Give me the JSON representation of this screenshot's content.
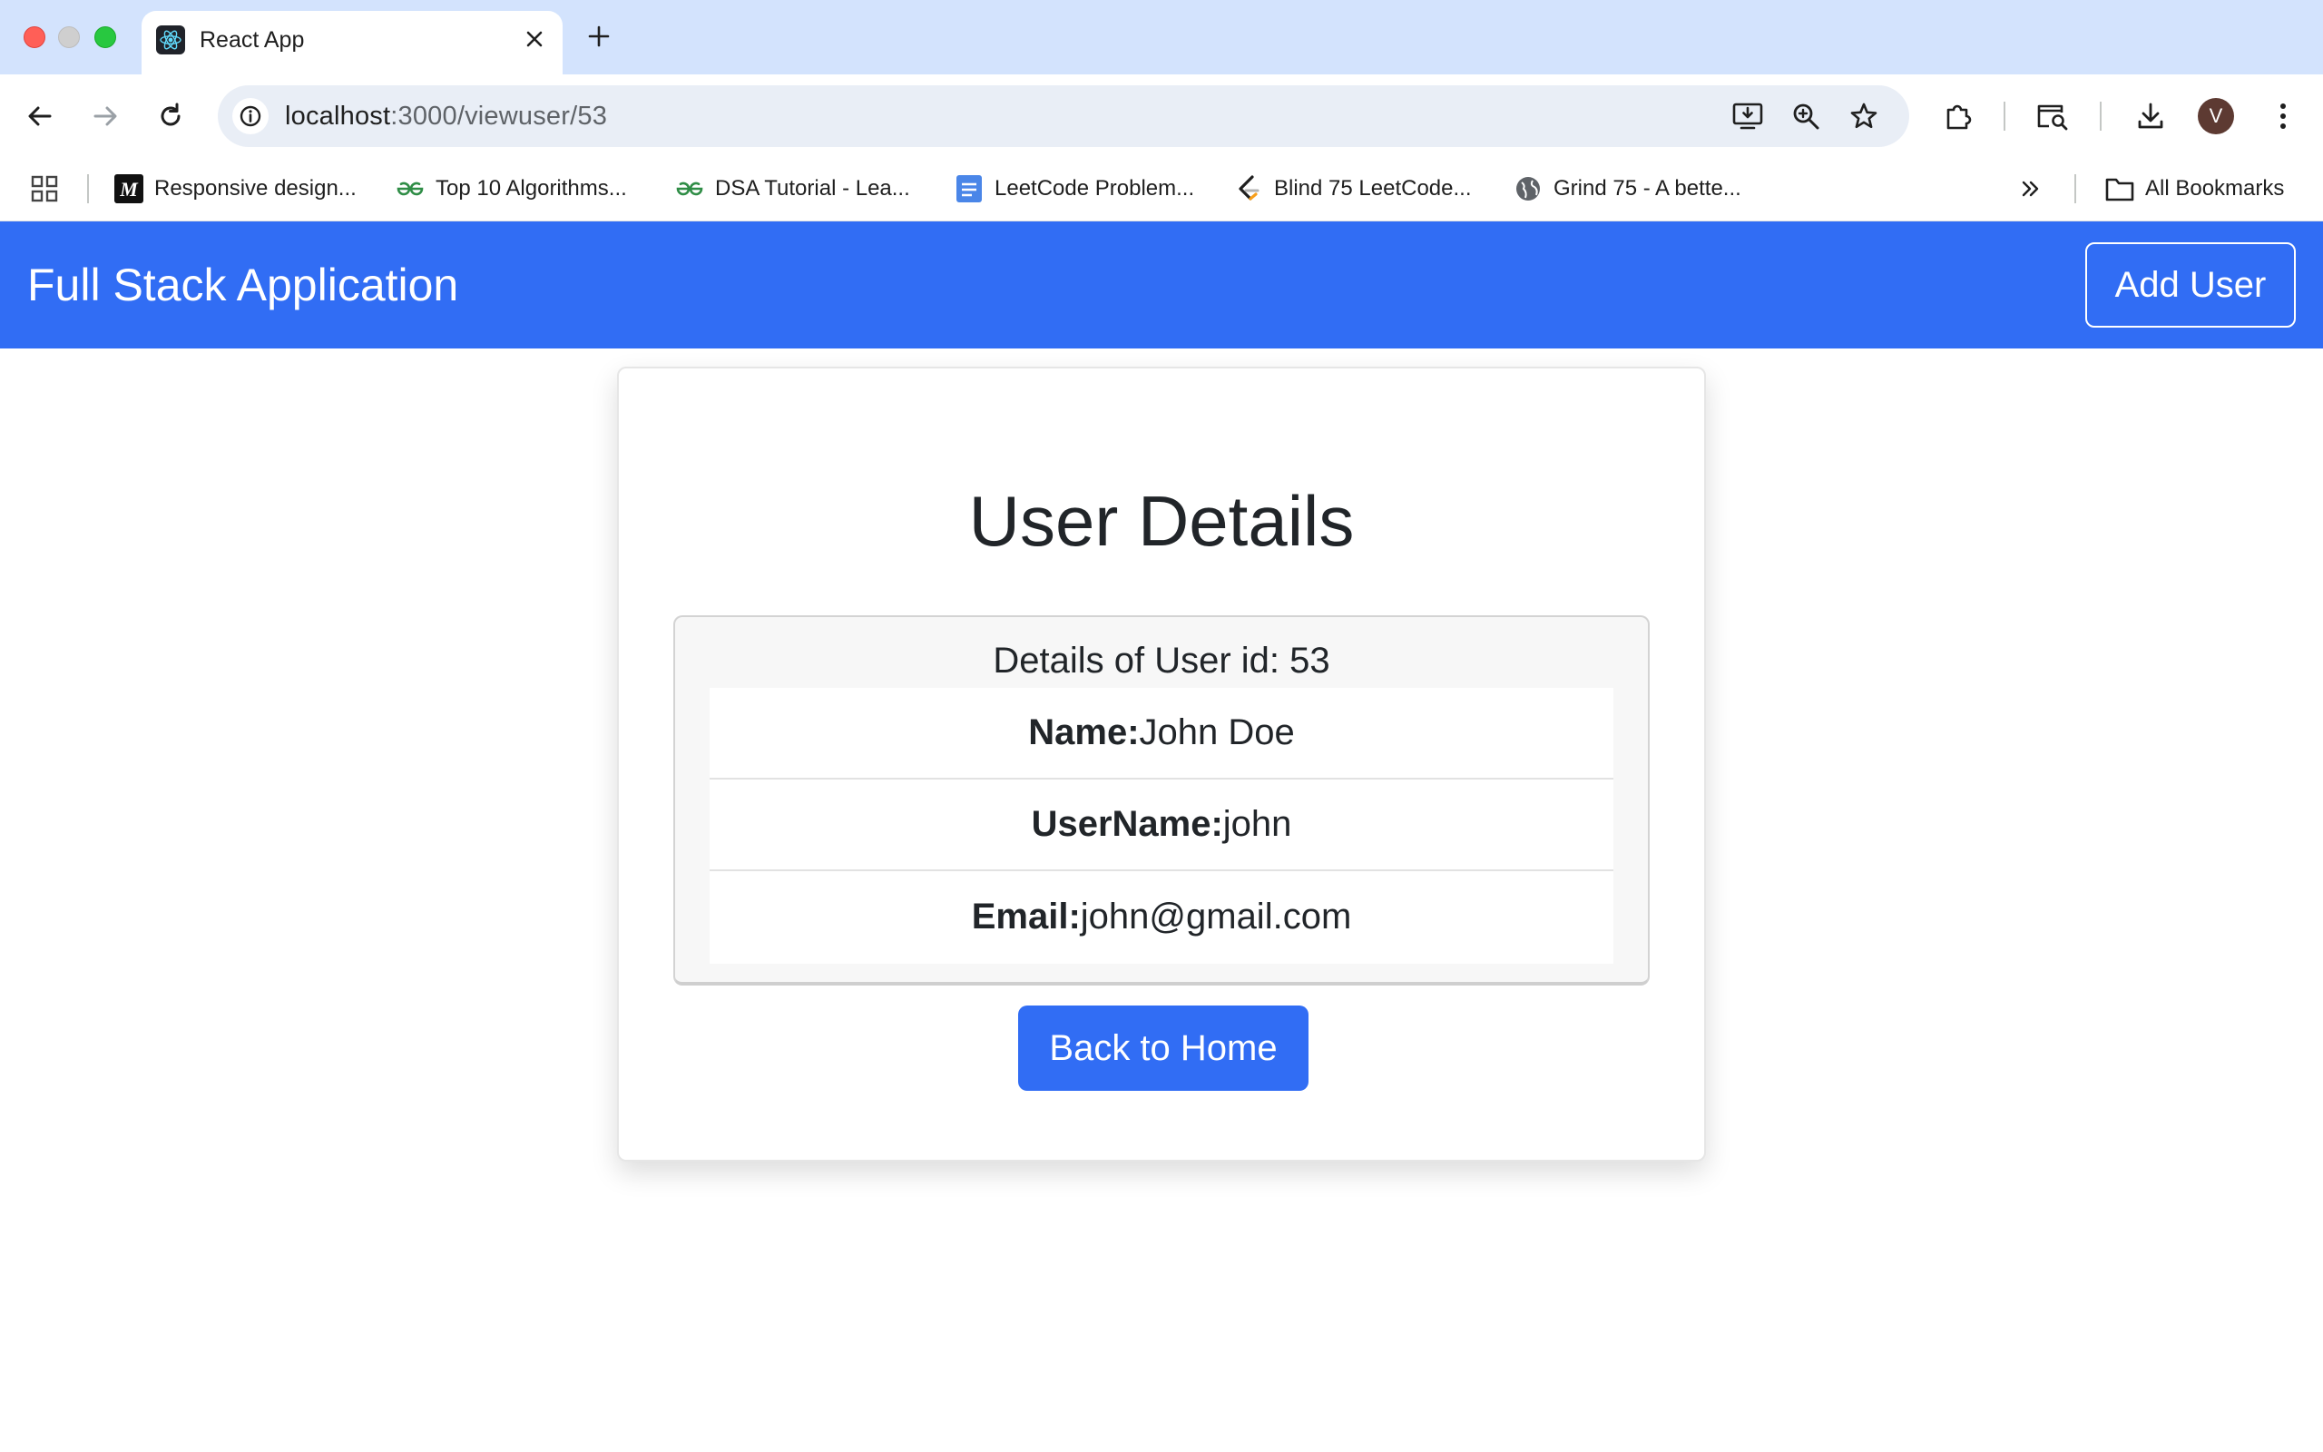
{
  "browser": {
    "tab": {
      "title": "React App",
      "favicon": "react-logo-icon"
    },
    "new_tab_label": "+",
    "url": {
      "host": "localhost",
      "path": ":3000/viewuser/53"
    },
    "profile_initial": "V",
    "bookmarks": [
      {
        "label": "Responsive design...",
        "icon": "medium-logo-icon"
      },
      {
        "label": "Top 10 Algorithms...",
        "icon": "geeksforgeeks-icon"
      },
      {
        "label": "DSA Tutorial - Lea...",
        "icon": "geeksforgeeks-icon"
      },
      {
        "label": "LeetCode Problem...",
        "icon": "google-docs-icon"
      },
      {
        "label": "Blind 75 LeetCode...",
        "icon": "leetcode-icon"
      },
      {
        "label": "Grind 75 - A bette...",
        "icon": "globe-icon"
      }
    ],
    "all_bookmarks_label": "All Bookmarks",
    "colors": {
      "tabstrip": "#d3e3fd",
      "omnibox": "#e9eef6"
    }
  },
  "app": {
    "navbar": {
      "brand": "Full Stack Application",
      "add_user_label": "Add User"
    },
    "page_title": "User Details",
    "details_header": "Details of User id: 53",
    "fields": [
      {
        "label": "Name:",
        "value": "John Doe"
      },
      {
        "label": "UserName:",
        "value": "john"
      },
      {
        "label": "Email:",
        "value": "john@gmail.com"
      }
    ],
    "back_button_label": "Back to Home",
    "colors": {
      "primary": "#316df4",
      "text": "#212529"
    }
  }
}
